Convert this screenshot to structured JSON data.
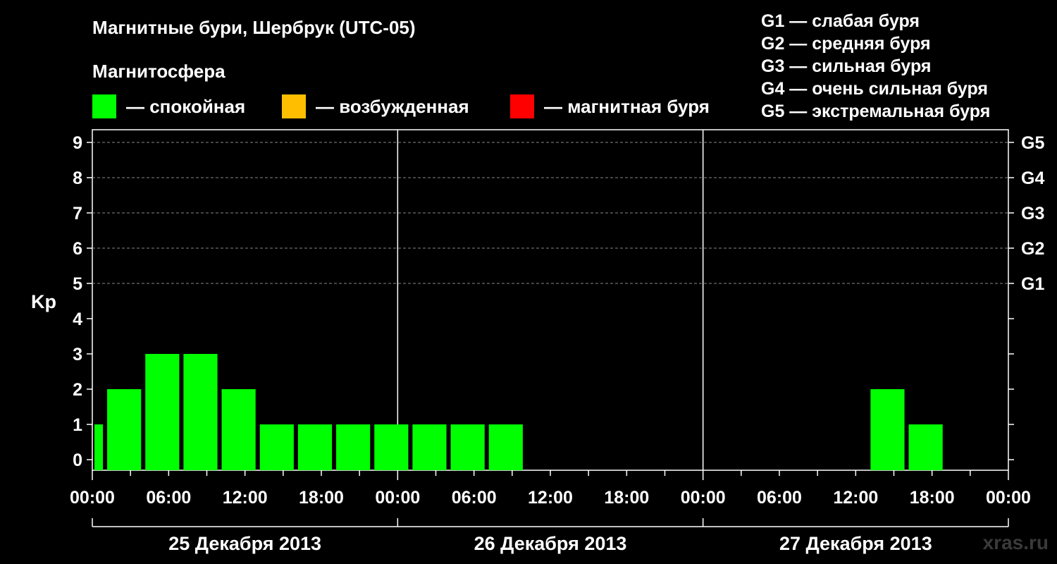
{
  "title": "Магнитные бури, Шербрук (UTC-05)",
  "subtitle": "Магнитосфера",
  "legend": [
    {
      "label": "— спокойная",
      "color": "#00ff00"
    },
    {
      "label": "— возбужденная",
      "color": "#ffbf00"
    },
    {
      "label": "— магнитная буря",
      "color": "#ff0000"
    }
  ],
  "storm_scale": [
    "G1 — слабая буря",
    "G2 — средняя буря",
    "G3 — сильная буря",
    "G4 — очень сильная буря",
    "G5 — экстремальная буря"
  ],
  "watermark": "xras.ru",
  "chart_data": {
    "type": "bar",
    "ylabel": "Kp",
    "ylim": [
      0,
      9
    ],
    "y_ticks": [
      0,
      1,
      2,
      3,
      4,
      5,
      6,
      7,
      8,
      9
    ],
    "right_axis_labels": [
      {
        "kp": 5,
        "label": "G1"
      },
      {
        "kp": 6,
        "label": "G2"
      },
      {
        "kp": 7,
        "label": "G3"
      },
      {
        "kp": 8,
        "label": "G4"
      },
      {
        "kp": 9,
        "label": "G5"
      }
    ],
    "x_tick_labels": [
      "00:00",
      "06:00",
      "12:00",
      "18:00",
      "00:00",
      "06:00",
      "12:00",
      "18:00",
      "00:00",
      "06:00",
      "12:00",
      "18:00",
      "00:00"
    ],
    "days": [
      "25 Декабря 2013",
      "26 Декабря 2013",
      "27 Декабря 2013"
    ],
    "gridlines_kp": [
      5,
      6,
      7,
      8,
      9
    ],
    "bar_color": "#00ff00",
    "series": [
      {
        "values": [
          {
            "start": "25 Декабря 2013 00:00",
            "end": "25 Декабря 2013 01:00",
            "kp": 1
          },
          {
            "start": "25 Декабря 2013 01:00",
            "end": "25 Декабря 2013 04:00",
            "kp": 2
          },
          {
            "start": "25 Декабря 2013 04:00",
            "end": "25 Декабря 2013 07:00",
            "kp": 3
          },
          {
            "start": "25 Декабря 2013 07:00",
            "end": "25 Декабря 2013 10:00",
            "kp": 3
          },
          {
            "start": "25 Декабря 2013 10:00",
            "end": "25 Декабря 2013 13:00",
            "kp": 2
          },
          {
            "start": "25 Декабря 2013 13:00",
            "end": "25 Декабря 2013 16:00",
            "kp": 1
          },
          {
            "start": "25 Декабря 2013 16:00",
            "end": "25 Декабря 2013 19:00",
            "kp": 1
          },
          {
            "start": "25 Декабря 2013 19:00",
            "end": "25 Декабря 2013 22:00",
            "kp": 1
          },
          {
            "start": "25 Декабря 2013 22:00",
            "end": "26 Декабря 2013 01:00",
            "kp": 1
          },
          {
            "start": "26 Декабря 2013 01:00",
            "end": "26 Декабря 2013 04:00",
            "kp": 1
          },
          {
            "start": "26 Декабря 2013 04:00",
            "end": "26 Декабря 2013 07:00",
            "kp": 1
          },
          {
            "start": "26 Декабря 2013 07:00",
            "end": "26 Декабря 2013 10:00",
            "kp": 1
          },
          {
            "start": "27 Декабря 2013 13:00",
            "end": "27 Декабря 2013 16:00",
            "kp": 2
          },
          {
            "start": "27 Декабря 2013 16:00",
            "end": "27 Декабря 2013 19:00",
            "kp": 1
          }
        ]
      }
    ]
  }
}
